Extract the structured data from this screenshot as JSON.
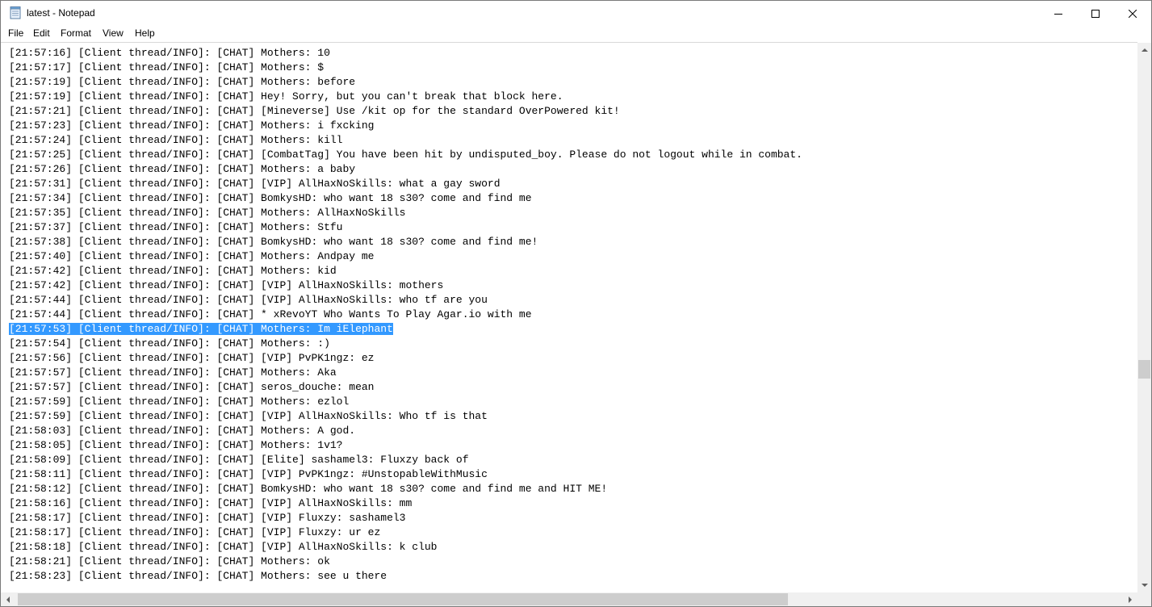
{
  "window": {
    "title": "latest - Notepad",
    "app_icon": "notepad-icon",
    "controls": {
      "minimize_icon": "minimize-icon",
      "maximize_icon": "maximize-icon",
      "close_icon": "close-icon"
    }
  },
  "menubar": {
    "items": [
      {
        "label": "File"
      },
      {
        "label": "Edit"
      },
      {
        "label": "Format"
      },
      {
        "label": "View"
      },
      {
        "label": "Help"
      }
    ]
  },
  "editor": {
    "selected_line_index": 19,
    "selection_color": "#3399ff",
    "lines": [
      "[21:57:16] [Client thread/INFO]: [CHAT] Mothers: 10",
      "[21:57:17] [Client thread/INFO]: [CHAT] Mothers: $",
      "[21:57:19] [Client thread/INFO]: [CHAT] Mothers: before",
      "[21:57:19] [Client thread/INFO]: [CHAT] Hey! Sorry, but you can't break that block here.",
      "[21:57:21] [Client thread/INFO]: [CHAT] [Mineverse] Use /kit op for the standard OverPowered kit!",
      "[21:57:23] [Client thread/INFO]: [CHAT] Mothers: i fxcking",
      "[21:57:24] [Client thread/INFO]: [CHAT] Mothers: kill",
      "[21:57:25] [Client thread/INFO]: [CHAT] [CombatTag] You have been hit by undisputed_boy. Please do not logout while in combat.",
      "[21:57:26] [Client thread/INFO]: [CHAT] Mothers: a baby",
      "[21:57:31] [Client thread/INFO]: [CHAT] [VIP] AllHaxNoSkills: what a gay sword",
      "[21:57:34] [Client thread/INFO]: [CHAT] BomkysHD: who want 18 s30? come and find me",
      "[21:57:35] [Client thread/INFO]: [CHAT] Mothers: AllHaxNoSkills",
      "[21:57:37] [Client thread/INFO]: [CHAT] Mothers: Stfu",
      "[21:57:38] [Client thread/INFO]: [CHAT] BomkysHD: who want 18 s30? come and find me!",
      "[21:57:40] [Client thread/INFO]: [CHAT] Mothers: Andpay me",
      "[21:57:42] [Client thread/INFO]: [CHAT] Mothers: kid",
      "[21:57:42] [Client thread/INFO]: [CHAT] [VIP] AllHaxNoSkills: mothers",
      "[21:57:44] [Client thread/INFO]: [CHAT] [VIP] AllHaxNoSkills: who tf are you",
      "[21:57:44] [Client thread/INFO]: [CHAT] * xRevoYT Who Wants To Play Agar.io with me",
      "[21:57:53] [Client thread/INFO]: [CHAT] Mothers: Im iElephant",
      "[21:57:54] [Client thread/INFO]: [CHAT] Mothers: :)",
      "[21:57:56] [Client thread/INFO]: [CHAT] [VIP] PvPK1ngz: ez",
      "[21:57:57] [Client thread/INFO]: [CHAT] Mothers: Aka",
      "[21:57:57] [Client thread/INFO]: [CHAT] seros_douche: mean",
      "[21:57:59] [Client thread/INFO]: [CHAT] Mothers: ezlol",
      "[21:57:59] [Client thread/INFO]: [CHAT] [VIP] AllHaxNoSkills: Who tf is that",
      "[21:58:03] [Client thread/INFO]: [CHAT] Mothers: A god.",
      "[21:58:05] [Client thread/INFO]: [CHAT] Mothers: 1v1?",
      "[21:58:09] [Client thread/INFO]: [CHAT] [Elite] sashamel3: Fluxzy back of",
      "[21:58:11] [Client thread/INFO]: [CHAT] [VIP] PvPK1ngz: #UnstopableWithMusic",
      "[21:58:12] [Client thread/INFO]: [CHAT] BomkysHD: who want 18 s30? come and find me and HIT ME!",
      "[21:58:16] [Client thread/INFO]: [CHAT] [VIP] AllHaxNoSkills: mm",
      "[21:58:17] [Client thread/INFO]: [CHAT] [VIP] Fluxzy: sashamel3",
      "[21:58:17] [Client thread/INFO]: [CHAT] [VIP] Fluxzy: ur ez",
      "[21:58:18] [Client thread/INFO]: [CHAT] [VIP] AllHaxNoSkills: k club",
      "[21:58:21] [Client thread/INFO]: [CHAT] Mothers: ok",
      "[21:58:23] [Client thread/INFO]: [CHAT] Mothers: see u there"
    ]
  },
  "scrollbars": {
    "vertical": {
      "up_icon": "scroll-up-arrow-icon",
      "down_icon": "scroll-down-arrow-icon"
    },
    "horizontal": {
      "left_icon": "scroll-left-arrow-icon",
      "right_icon": "scroll-right-arrow-icon"
    }
  }
}
